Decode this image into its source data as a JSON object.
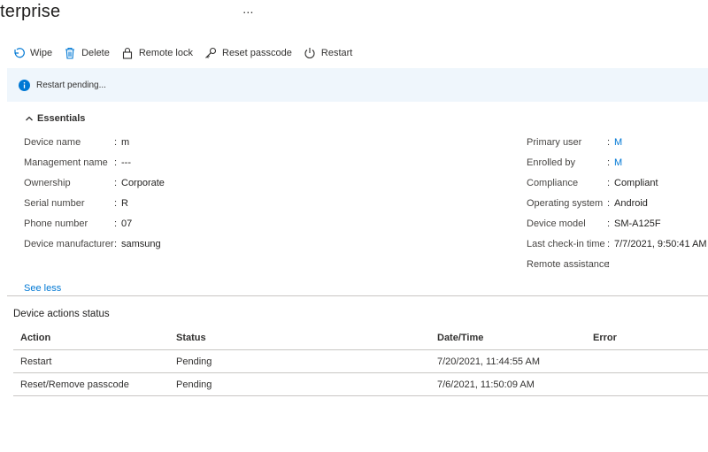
{
  "header": {
    "title": "terprise",
    "more": "..."
  },
  "toolbar": {
    "items": [
      {
        "label": "Wipe",
        "icon": "wipe-icon"
      },
      {
        "label": "Delete",
        "icon": "trash-icon"
      },
      {
        "label": "Remote lock",
        "icon": "lock-icon"
      },
      {
        "label": "Reset passcode",
        "icon": "key-icon"
      },
      {
        "label": "Restart",
        "icon": "power-icon"
      }
    ]
  },
  "banner": {
    "message": "Restart pending...",
    "icon": "info-icon",
    "color": "#0078d4"
  },
  "essentials": {
    "title": "Essentials",
    "left": [
      {
        "key": "Device name",
        "value": "m"
      },
      {
        "key": "Management name",
        "value": "---"
      },
      {
        "key": "Ownership",
        "value": "Corporate"
      },
      {
        "key": "Serial number",
        "value": "R"
      },
      {
        "key": "Phone number",
        "value": "07"
      },
      {
        "key": "Device manufacturer",
        "value": "samsung"
      }
    ],
    "right": [
      {
        "key": "Primary user",
        "value": "M"
      },
      {
        "key": "Enrolled by",
        "value": "M"
      },
      {
        "key": "Compliance",
        "value": "Compliant"
      },
      {
        "key": "Operating system",
        "value": "Android"
      },
      {
        "key": "Device model",
        "value": "SM-A125F"
      },
      {
        "key": "Last check-in time",
        "value": "7/7/2021, 9:50:41 AM"
      },
      {
        "key": "Remote assistance",
        "value": ""
      }
    ],
    "see_less": "See less"
  },
  "status": {
    "title": "Device actions status",
    "columns": [
      "Action",
      "Status",
      "Date/Time",
      "Error"
    ],
    "rows": [
      [
        "Restart",
        "Pending",
        "7/20/2021, 11:44:55 AM",
        ""
      ],
      [
        "Reset/Remove passcode",
        "Pending",
        "7/6/2021, 11:50:09 AM",
        ""
      ]
    ]
  }
}
